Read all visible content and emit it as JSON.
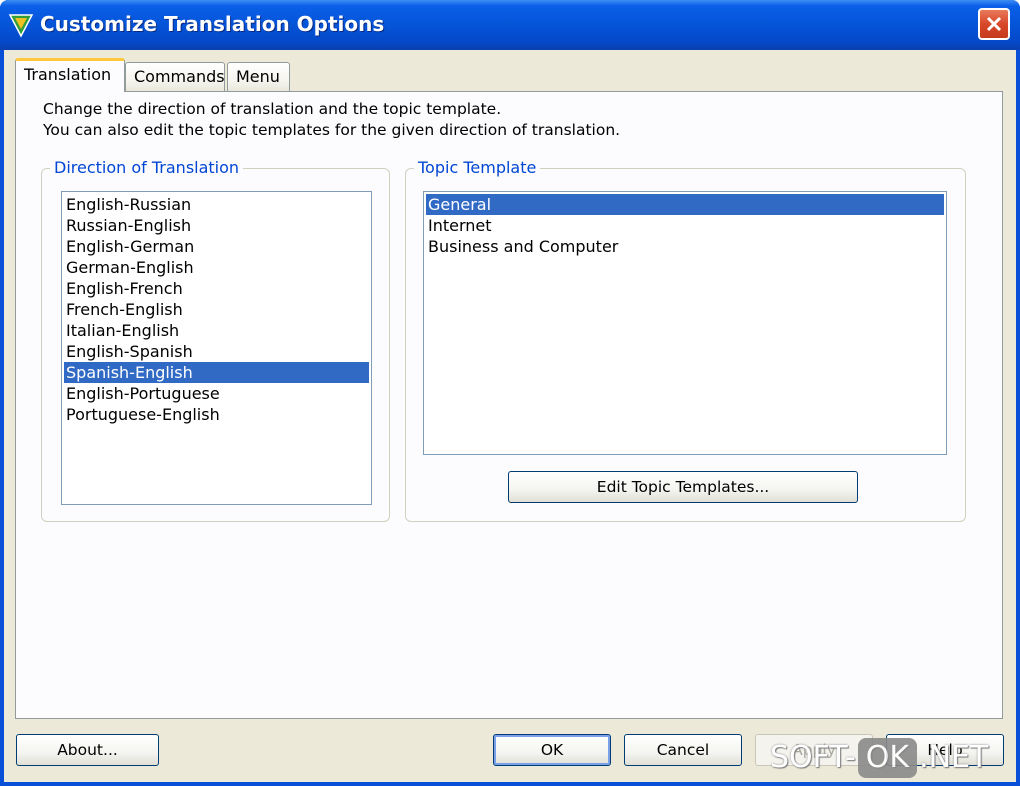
{
  "window": {
    "title": "Customize Translation Options"
  },
  "tabs": [
    {
      "label": "Translation",
      "active": true
    },
    {
      "label": "Commands",
      "active": false
    },
    {
      "label": "Menu",
      "active": false
    }
  ],
  "description": {
    "line1": "Change the direction of translation and the topic template.",
    "line2": "You can also edit the topic templates for the given direction of translation."
  },
  "direction_group": {
    "label": "Direction of Translation",
    "items": [
      "English-Russian",
      "Russian-English",
      "English-German",
      "German-English",
      "English-French",
      "French-English",
      "Italian-English",
      "English-Spanish",
      "Spanish-English",
      "English-Portuguese",
      "Portuguese-English"
    ],
    "selected": "Spanish-English"
  },
  "topic_group": {
    "label": "Topic Template",
    "items": [
      "General",
      "Internet",
      "Business and Computer"
    ],
    "selected": "General",
    "edit_button": "Edit Topic Templates..."
  },
  "footer": {
    "about": "About...",
    "ok": "OK",
    "cancel": "Cancel",
    "apply": "Apply",
    "help": "Help"
  },
  "watermark": {
    "left": "SOFT-",
    "box": "OK",
    "right": ".NET"
  },
  "colors": {
    "titlebar": "#0554d8",
    "selection": "#316ac5",
    "group_label": "#0046d5",
    "dialog_bg": "#ece9d8"
  },
  "icons": {
    "app": "translator-v-logo-icon",
    "close": "close-x-icon"
  }
}
